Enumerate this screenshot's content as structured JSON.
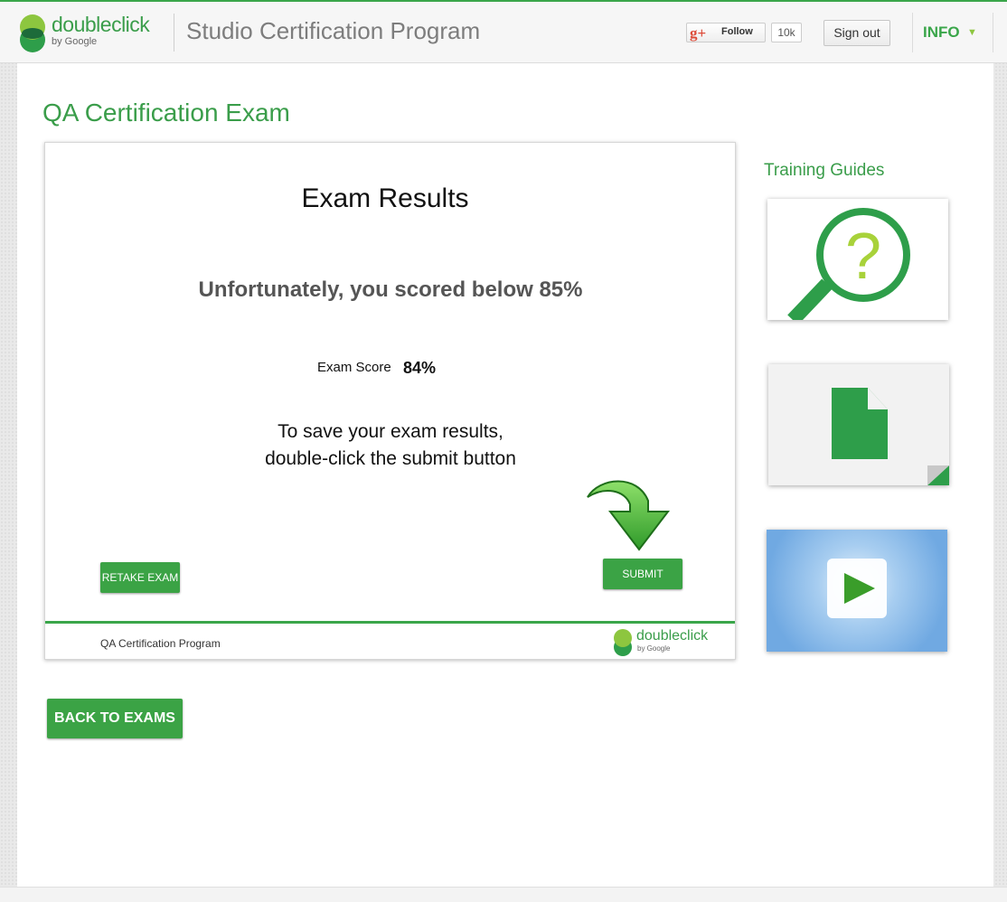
{
  "header": {
    "logo_word": "doubleclick",
    "logo_by": "by Google",
    "program_title": "Studio Certification Program",
    "gplus_icon": "g+",
    "follow_label": "Follow",
    "follow_count": "10k",
    "signout_label": "Sign out",
    "info_label": "INFO",
    "info_arrow": "▼"
  },
  "page": {
    "title": "QA Certification Exam"
  },
  "exam": {
    "heading": "Exam Results",
    "fail_message": "Unfortunately, you scored below 85%",
    "score_label": "Exam Score",
    "score_value": "84%",
    "save_line1": "To save your exam results,",
    "save_line2": "double-click the submit button",
    "submit_label": "SUBMIT",
    "retake_label": "RETAKE EXAM",
    "footer_text": "QA Certification Program",
    "footer_logo_word": "doubleclick",
    "footer_logo_by": "by Google"
  },
  "back_label": "BACK TO EXAMS",
  "sidebar": {
    "title": "Training Guides",
    "guides": [
      {
        "icon": "magnifier-question-icon"
      },
      {
        "icon": "document-icon"
      },
      {
        "icon": "play-icon"
      }
    ]
  },
  "colors": {
    "brand_green": "#3aa64a",
    "light_green": "#8dc63f",
    "button_green": "#3ba345"
  }
}
